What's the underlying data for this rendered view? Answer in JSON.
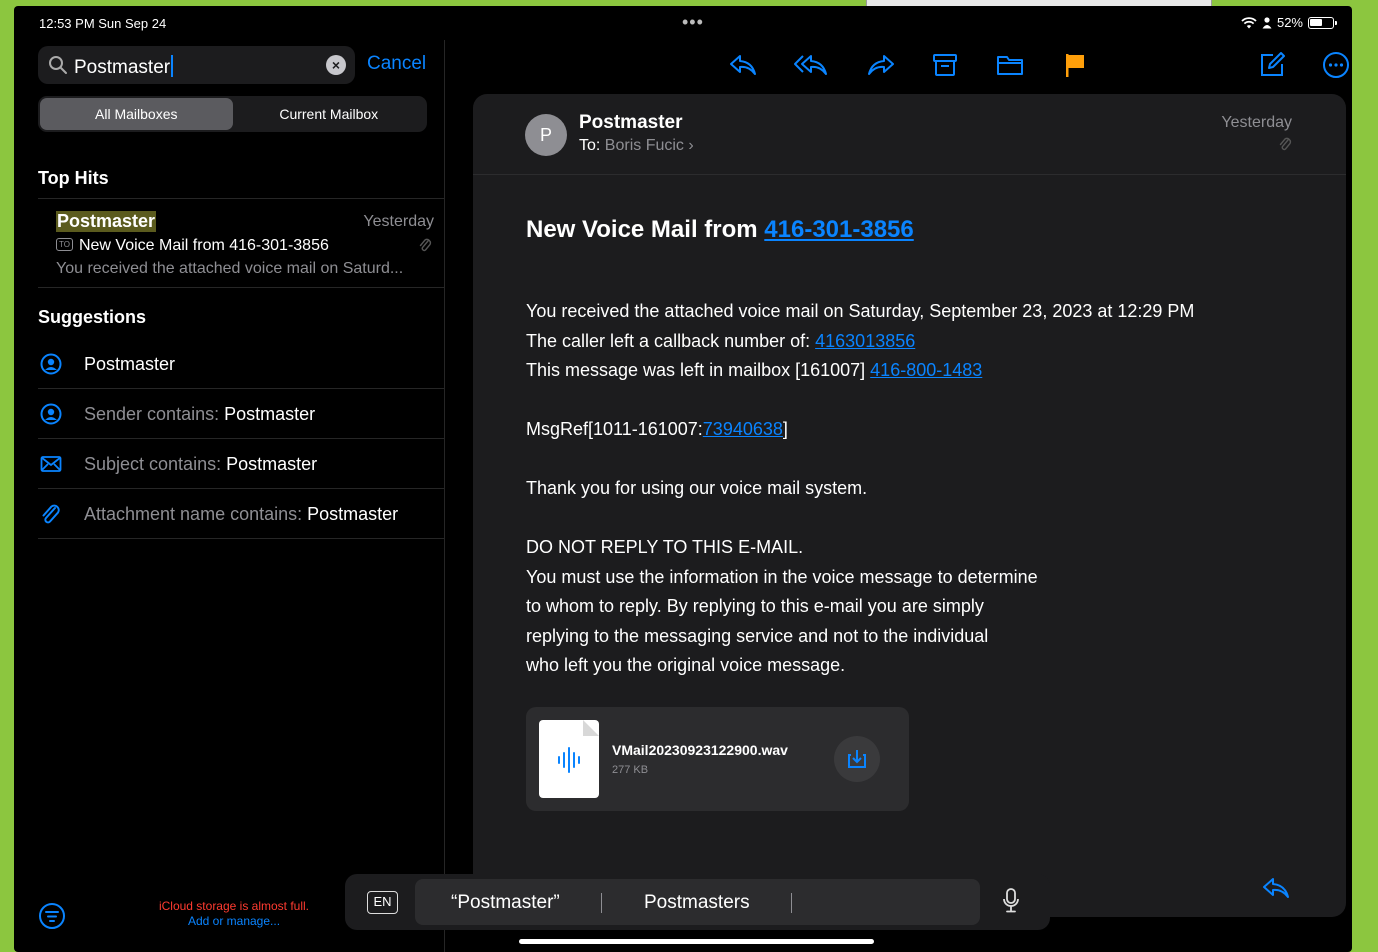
{
  "status": {
    "time_date": "12:53 PM  Sun Sep 24",
    "battery": "52%"
  },
  "sidebar": {
    "search_value": "Postmaster",
    "cancel_label": "Cancel",
    "scopes": [
      "All Mailboxes",
      "Current Mailbox"
    ],
    "top_hits_title": "Top Hits",
    "hit": {
      "from": "Postmaster",
      "date": "Yesterday",
      "to_badge": "TO",
      "subject": "New Voice Mail from 416-301-3856",
      "preview": "You received the attached voice mail on Saturd..."
    },
    "suggestions_title": "Suggestions",
    "suggestions": [
      {
        "icon": "person-circle-icon",
        "prefix": "",
        "value": "Postmaster"
      },
      {
        "icon": "person-circle-icon",
        "prefix": "Sender contains: ",
        "value": "Postmaster"
      },
      {
        "icon": "envelope-icon",
        "prefix": "Subject contains: ",
        "value": "Postmaster"
      },
      {
        "icon": "paperclip-icon",
        "prefix": "Attachment name contains: ",
        "value": "Postmaster"
      }
    ],
    "icloud_line1": "iCloud storage is almost full.",
    "icloud_line2": "Add or manage..."
  },
  "message": {
    "avatar_letter": "P",
    "sender": "Postmaster",
    "to_label": "To:",
    "to_name": "Boris Fucic",
    "date": "Yesterday",
    "headline_prefix": "New Voice Mail from ",
    "headline_link": "416-301-3856",
    "line1": "You received the attached voice mail on Saturday, September 23, 2023 at 12:29 PM",
    "line2_prefix": "The caller left a callback number of: ",
    "line2_link": "4163013856",
    "line3_prefix": "This message was left in mailbox [161007] ",
    "line3_link": "416-800-1483",
    "msgref_prefix": "MsgRef[1011-161007:",
    "msgref_link": "73940638",
    "msgref_suffix": "]",
    "thanks": "Thank you for using our voice mail system.",
    "notice": [
      "DO NOT REPLY TO THIS E-MAIL.",
      "You must use the information in the voice message to determine",
      "to whom to reply.  By replying to this e-mail you are simply",
      "replying to the messaging service and not to the individual",
      "who left you the original voice message."
    ],
    "attachment": {
      "name": "VMail20230923122900.wav",
      "size": "277 KB"
    }
  },
  "keyboard": {
    "lang": "EN",
    "suggestion1": "“Postmaster”",
    "suggestion2": "Postmasters"
  },
  "colors": {
    "accent": "#0a84ff",
    "flag": "#ff9f0a",
    "frame": "#8cc63f"
  }
}
